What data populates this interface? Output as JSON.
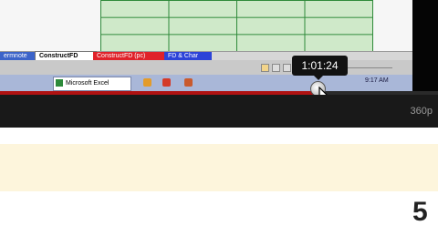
{
  "sheet_tabs": [
    "ermnote",
    "ConstructFD",
    "ConstructFD (pc)",
    "FD & Char"
  ],
  "taskbar": {
    "excel_label": "Microsoft Excel",
    "clock": "9:17 AM"
  },
  "player": {
    "time_tooltip": "1:01:24",
    "quality": "360p",
    "progress_fraction": 0.72
  },
  "page": {
    "count": "5"
  },
  "colors": {
    "progress": "#b01212",
    "grid_line": "#2f8a3a",
    "band": "#fdf5dc"
  }
}
